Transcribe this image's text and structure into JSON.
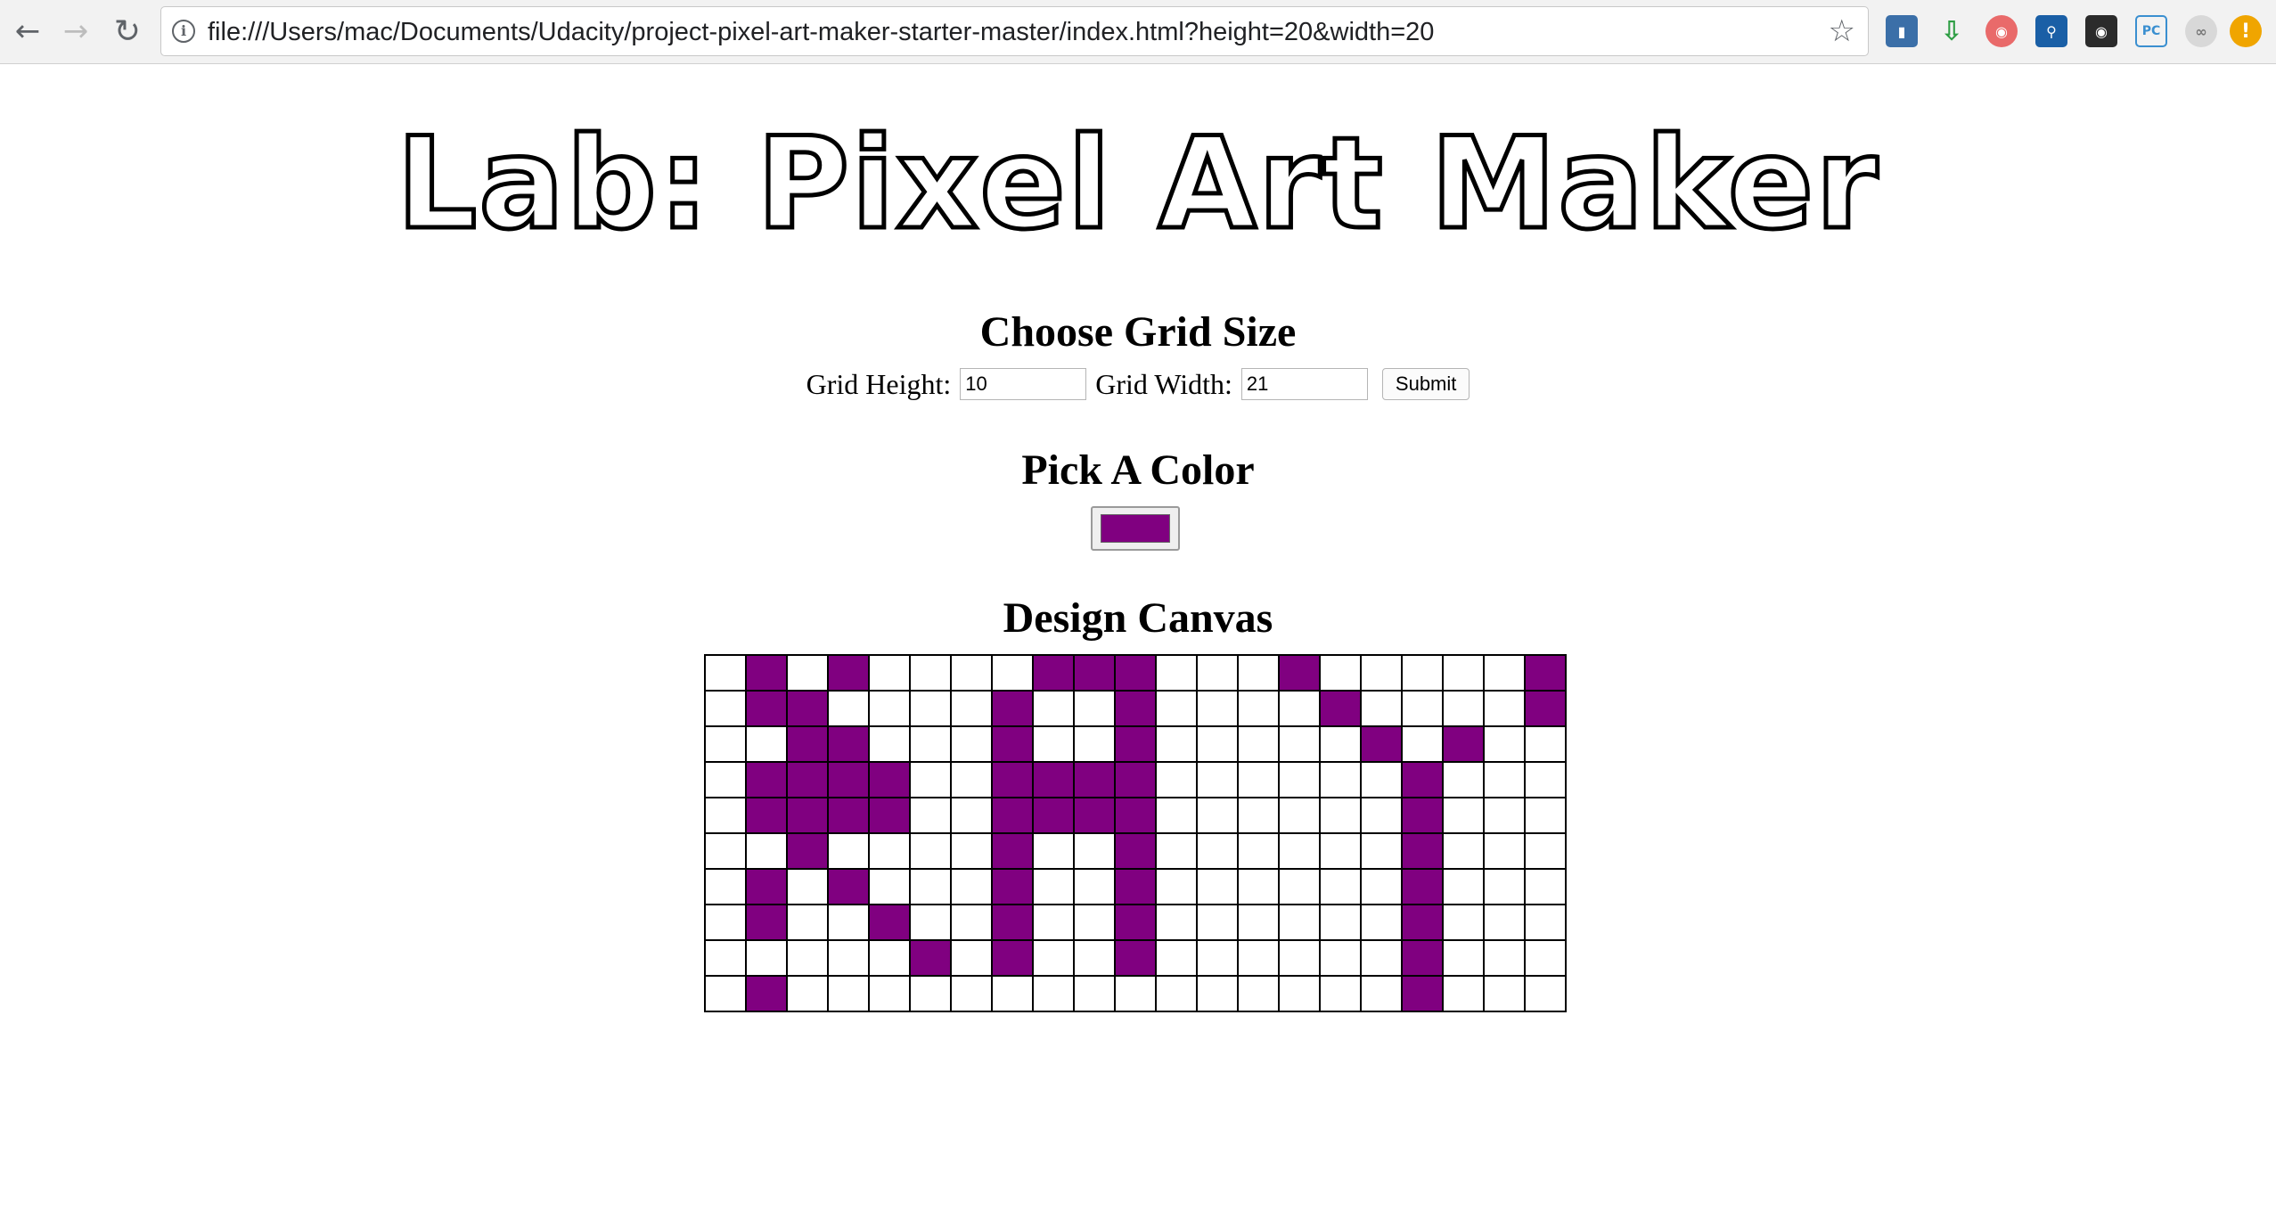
{
  "browser": {
    "url": "file:///Users/mac/Documents/Udacity/project-pixel-art-maker-starter-master/index.html?height=20&width=20",
    "extensions": [
      "clapper-icon",
      "download-arrow-icon",
      "instagram-icon",
      "search-magnifier-icon",
      "ghostery-icon",
      "pc-icon",
      "visual-icon",
      "warning-icon"
    ]
  },
  "page": {
    "title": "Lab: Pixel Art Maker",
    "grid_heading": "Choose Grid Size",
    "height_label": "Grid Height:",
    "height_value": "10",
    "width_label": "Grid Width:",
    "width_value": "21",
    "submit_label": "Submit",
    "color_heading": "Pick A Color",
    "color_value": "#800080",
    "canvas_heading": "Design Canvas"
  },
  "canvas": {
    "rows": 10,
    "cols": 21,
    "fill_color": "#800080",
    "pixels": [
      "010100001110001000001",
      "011000010010000100001",
      "001100010010000010100",
      "011110011110000001000",
      "011110011110000001000",
      "001000010010000001000",
      "010100010010000001000",
      "010010010010000001000",
      "000001010010000001000",
      "010000000000000001000"
    ]
  }
}
